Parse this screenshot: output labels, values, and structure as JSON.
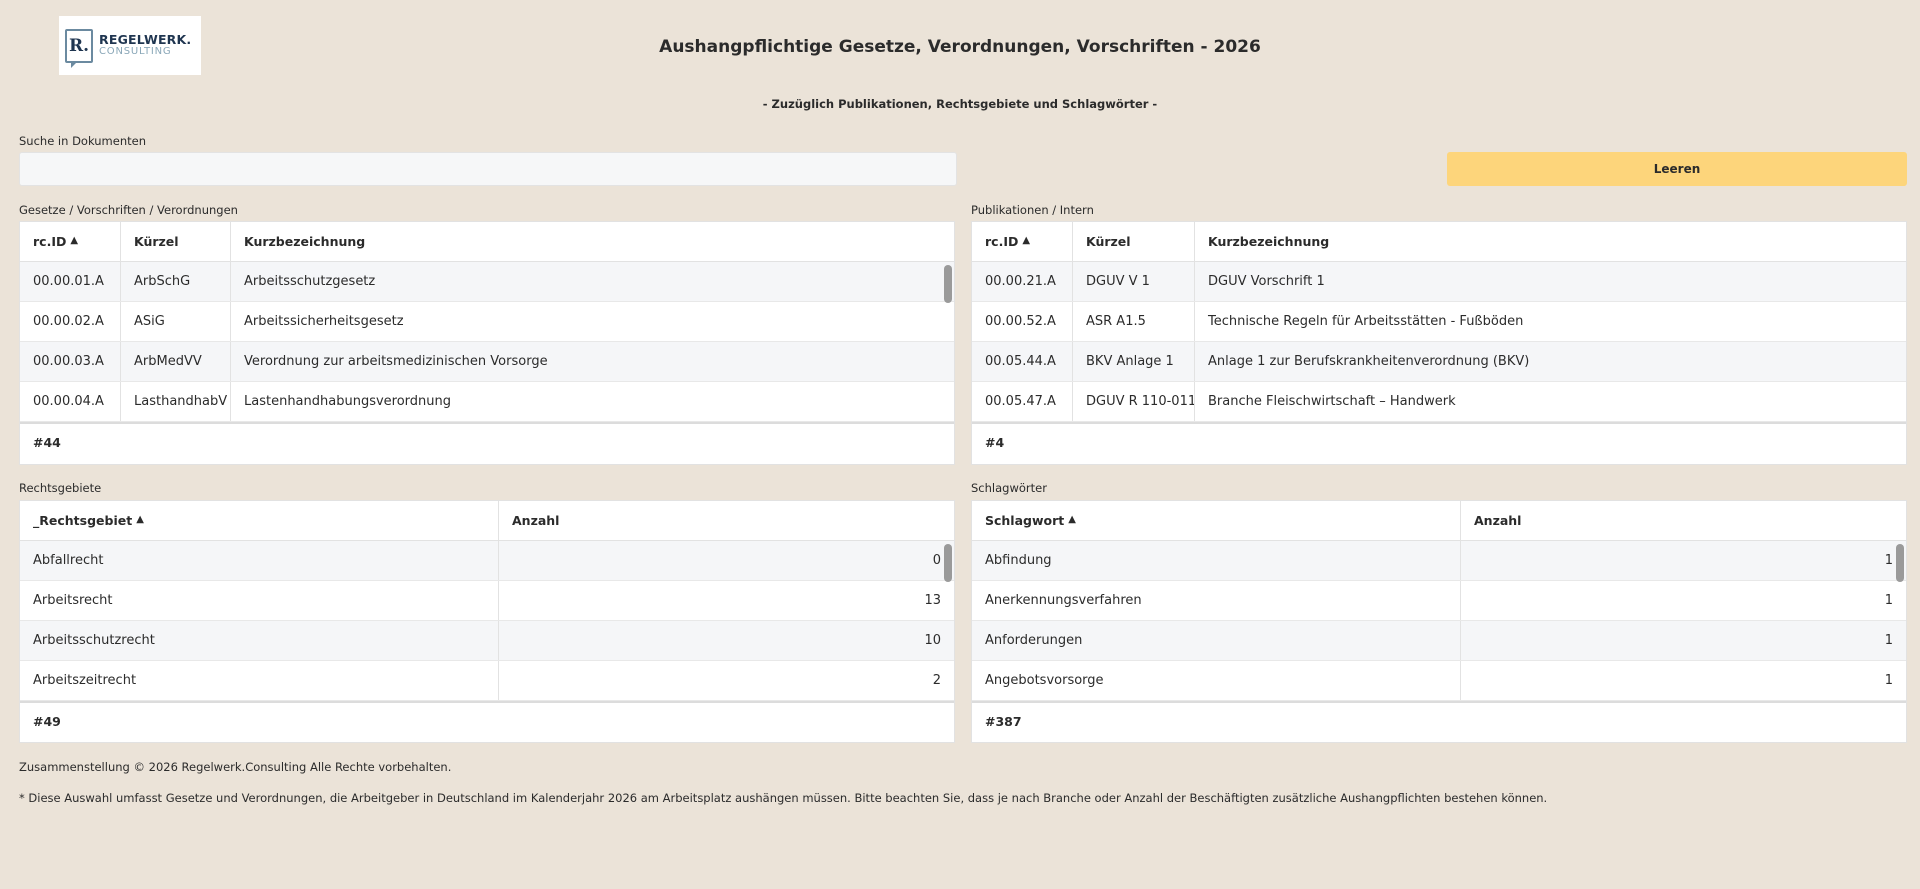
{
  "logo": {
    "mark": "R.",
    "line1": "REGELWERK.",
    "line2": "CONSULTING"
  },
  "header": {
    "title": "Aushangpflichtige Gesetze, Verordnungen, Vorschriften - 2026",
    "subtitle": "- Zuzüglich Publikationen, Rechtsgebiete und Schlagwörter -"
  },
  "search": {
    "label": "Suche in Dokumenten",
    "value": "",
    "placeholder": "",
    "clear_label": "Leeren"
  },
  "laws": {
    "label": "Gesetze / Vorschriften / Verordnungen",
    "columns": [
      "rc.ID",
      "Kürzel",
      "Kurzbezeichnung"
    ],
    "rows": [
      [
        "00.00.01.A",
        "ArbSchG",
        "Arbeitsschutzgesetz"
      ],
      [
        "00.00.02.A",
        "ASiG",
        "Arbeitssicherheitsgesetz"
      ],
      [
        "00.00.03.A",
        "ArbMedVV",
        "Verordnung zur arbeitsmedizinischen Vorsorge"
      ],
      [
        "00.00.04.A",
        "LasthandhabV",
        "Lastenhandhabungsverordnung"
      ]
    ],
    "count": "#44"
  },
  "publications": {
    "label": "Publikationen / Intern",
    "columns": [
      "rc.ID",
      "Kürzel",
      "Kurzbezeichnung"
    ],
    "rows": [
      [
        "00.00.21.A",
        "DGUV V 1",
        "DGUV Vorschrift 1"
      ],
      [
        "00.00.52.A",
        "ASR A1.5",
        "Technische Regeln für Arbeitsstätten - Fußböden"
      ],
      [
        "00.05.44.A",
        "BKV Anlage 1",
        "Anlage 1 zur Berufskrankheitenverordnung (BKV)"
      ],
      [
        "00.05.47.A",
        "DGUV R 110-011",
        "Branche Fleischwirtschaft – Handwerk"
      ]
    ],
    "count": "#4"
  },
  "areas": {
    "label": "Rechtsgebiete",
    "columns": [
      "_Rechtsgebiet",
      "Anzahl"
    ],
    "rows": [
      [
        "Abfallrecht",
        "0"
      ],
      [
        "Arbeitsrecht",
        "13"
      ],
      [
        "Arbeitsschutzrecht",
        "10"
      ],
      [
        "Arbeitszeitrecht",
        "2"
      ]
    ],
    "count": "#49"
  },
  "keywords": {
    "label": "Schlagwörter",
    "columns": [
      "Schlagwort",
      "Anzahl"
    ],
    "rows": [
      [
        "Abfindung",
        "1"
      ],
      [
        "Anerkennungsverfahren",
        "1"
      ],
      [
        "Anforderungen",
        "1"
      ],
      [
        "Angebotsvorsorge",
        "1"
      ]
    ],
    "count": "#387"
  },
  "footer": {
    "copyright": "Zusammenstellung © 2026 Regelwerk.Consulting  Alle Rechte vorbehalten.",
    "note": "* Diese Auswahl umfasst Gesetze und Verordnungen, die Arbeitgeber in Deutschland im Kalenderjahr 2026 am Arbeitsplatz aushängen müssen. Bitte beachten Sie, dass je nach Branche oder Anzahl der Beschäftigten zusätzliche Aushangpflichten bestehen können."
  },
  "colors": {
    "background": "#ebe3d8",
    "accent_button": "#fdd57b",
    "row_alt": "#f5f6f8"
  },
  "icons": {
    "sort": "sort-ascending-icon"
  }
}
